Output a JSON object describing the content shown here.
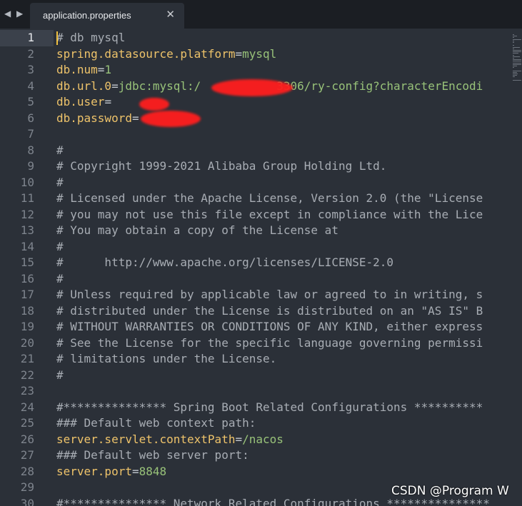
{
  "window": {
    "back_icon": "triangle-left-icon",
    "forward_icon": "triangle-right-icon",
    "tab_title": "application.properties",
    "tab_close_icon": "close-icon"
  },
  "editor": {
    "active_line": 1,
    "lines": [
      {
        "n": "1",
        "parts": [
          {
            "t": "# db mysql",
            "c": "comment"
          }
        ]
      },
      {
        "n": "2",
        "parts": [
          {
            "t": "spring.datasource.platform",
            "c": "key"
          },
          {
            "t": "=",
            "c": "eq"
          },
          {
            "t": "mysql",
            "c": "val"
          }
        ]
      },
      {
        "n": "3",
        "parts": [
          {
            "t": "db.num",
            "c": "key"
          },
          {
            "t": "=",
            "c": "eq"
          },
          {
            "t": "1",
            "c": "val"
          }
        ]
      },
      {
        "n": "4",
        "parts": [
          {
            "t": "db.url.0",
            "c": "key"
          },
          {
            "t": "=",
            "c": "eq"
          },
          {
            "t": "jdbc:mysql:/",
            "c": "val"
          },
          {
            "t": "           ",
            "c": "val"
          },
          {
            "t": "3306/ry-config?characterEncodi",
            "c": "val"
          }
        ]
      },
      {
        "n": "5",
        "parts": [
          {
            "t": "db.user",
            "c": "key"
          },
          {
            "t": "=",
            "c": "eq"
          }
        ]
      },
      {
        "n": "6",
        "parts": [
          {
            "t": "db.password",
            "c": "key"
          },
          {
            "t": "=",
            "c": "eq"
          }
        ]
      },
      {
        "n": "7",
        "parts": []
      },
      {
        "n": "8",
        "parts": [
          {
            "t": "#",
            "c": "comment"
          }
        ]
      },
      {
        "n": "9",
        "parts": [
          {
            "t": "# Copyright 1999-2021 Alibaba Group Holding Ltd.",
            "c": "comment"
          }
        ]
      },
      {
        "n": "10",
        "parts": [
          {
            "t": "#",
            "c": "comment"
          }
        ]
      },
      {
        "n": "11",
        "parts": [
          {
            "t": "# Licensed under the Apache License, Version 2.0 (the \"License",
            "c": "comment"
          }
        ]
      },
      {
        "n": "12",
        "parts": [
          {
            "t": "# you may not use this file except in compliance with the Lice",
            "c": "comment"
          }
        ]
      },
      {
        "n": "13",
        "parts": [
          {
            "t": "# You may obtain a copy of the License at",
            "c": "comment"
          }
        ]
      },
      {
        "n": "14",
        "parts": [
          {
            "t": "#",
            "c": "comment"
          }
        ]
      },
      {
        "n": "15",
        "parts": [
          {
            "t": "#      http://www.apache.org/licenses/LICENSE-2.0",
            "c": "comment"
          }
        ]
      },
      {
        "n": "16",
        "parts": [
          {
            "t": "#",
            "c": "comment"
          }
        ]
      },
      {
        "n": "17",
        "parts": [
          {
            "t": "# Unless required by applicable law or agreed to in writing, s",
            "c": "comment"
          }
        ]
      },
      {
        "n": "18",
        "parts": [
          {
            "t": "# distributed under the License is distributed on an \"AS IS\" B",
            "c": "comment"
          }
        ]
      },
      {
        "n": "19",
        "parts": [
          {
            "t": "# WITHOUT WARRANTIES OR CONDITIONS OF ANY KIND, either express",
            "c": "comment"
          }
        ]
      },
      {
        "n": "20",
        "parts": [
          {
            "t": "# See the License for the specific language governing permissi",
            "c": "comment"
          }
        ]
      },
      {
        "n": "21",
        "parts": [
          {
            "t": "# limitations under the License.",
            "c": "comment"
          }
        ]
      },
      {
        "n": "22",
        "parts": [
          {
            "t": "#",
            "c": "comment"
          }
        ]
      },
      {
        "n": "23",
        "parts": []
      },
      {
        "n": "24",
        "parts": [
          {
            "t": "#*************** Spring Boot Related Configurations **********",
            "c": "comment"
          }
        ]
      },
      {
        "n": "25",
        "parts": [
          {
            "t": "### Default web context path:",
            "c": "comment"
          }
        ]
      },
      {
        "n": "26",
        "parts": [
          {
            "t": "server.servlet.contextPath",
            "c": "key"
          },
          {
            "t": "=",
            "c": "eq"
          },
          {
            "t": "/nacos",
            "c": "val"
          }
        ]
      },
      {
        "n": "27",
        "parts": [
          {
            "t": "### Default web server port:",
            "c": "comment"
          }
        ]
      },
      {
        "n": "28",
        "parts": [
          {
            "t": "server.port",
            "c": "key"
          },
          {
            "t": "=",
            "c": "eq"
          },
          {
            "t": "8848",
            "c": "val"
          }
        ]
      },
      {
        "n": "29",
        "parts": []
      },
      {
        "n": "30",
        "parts": [
          {
            "t": "#*************** Network Related Configurations ***************",
            "c": "comment"
          }
        ]
      }
    ]
  },
  "watermark": "CSDN @Program W"
}
